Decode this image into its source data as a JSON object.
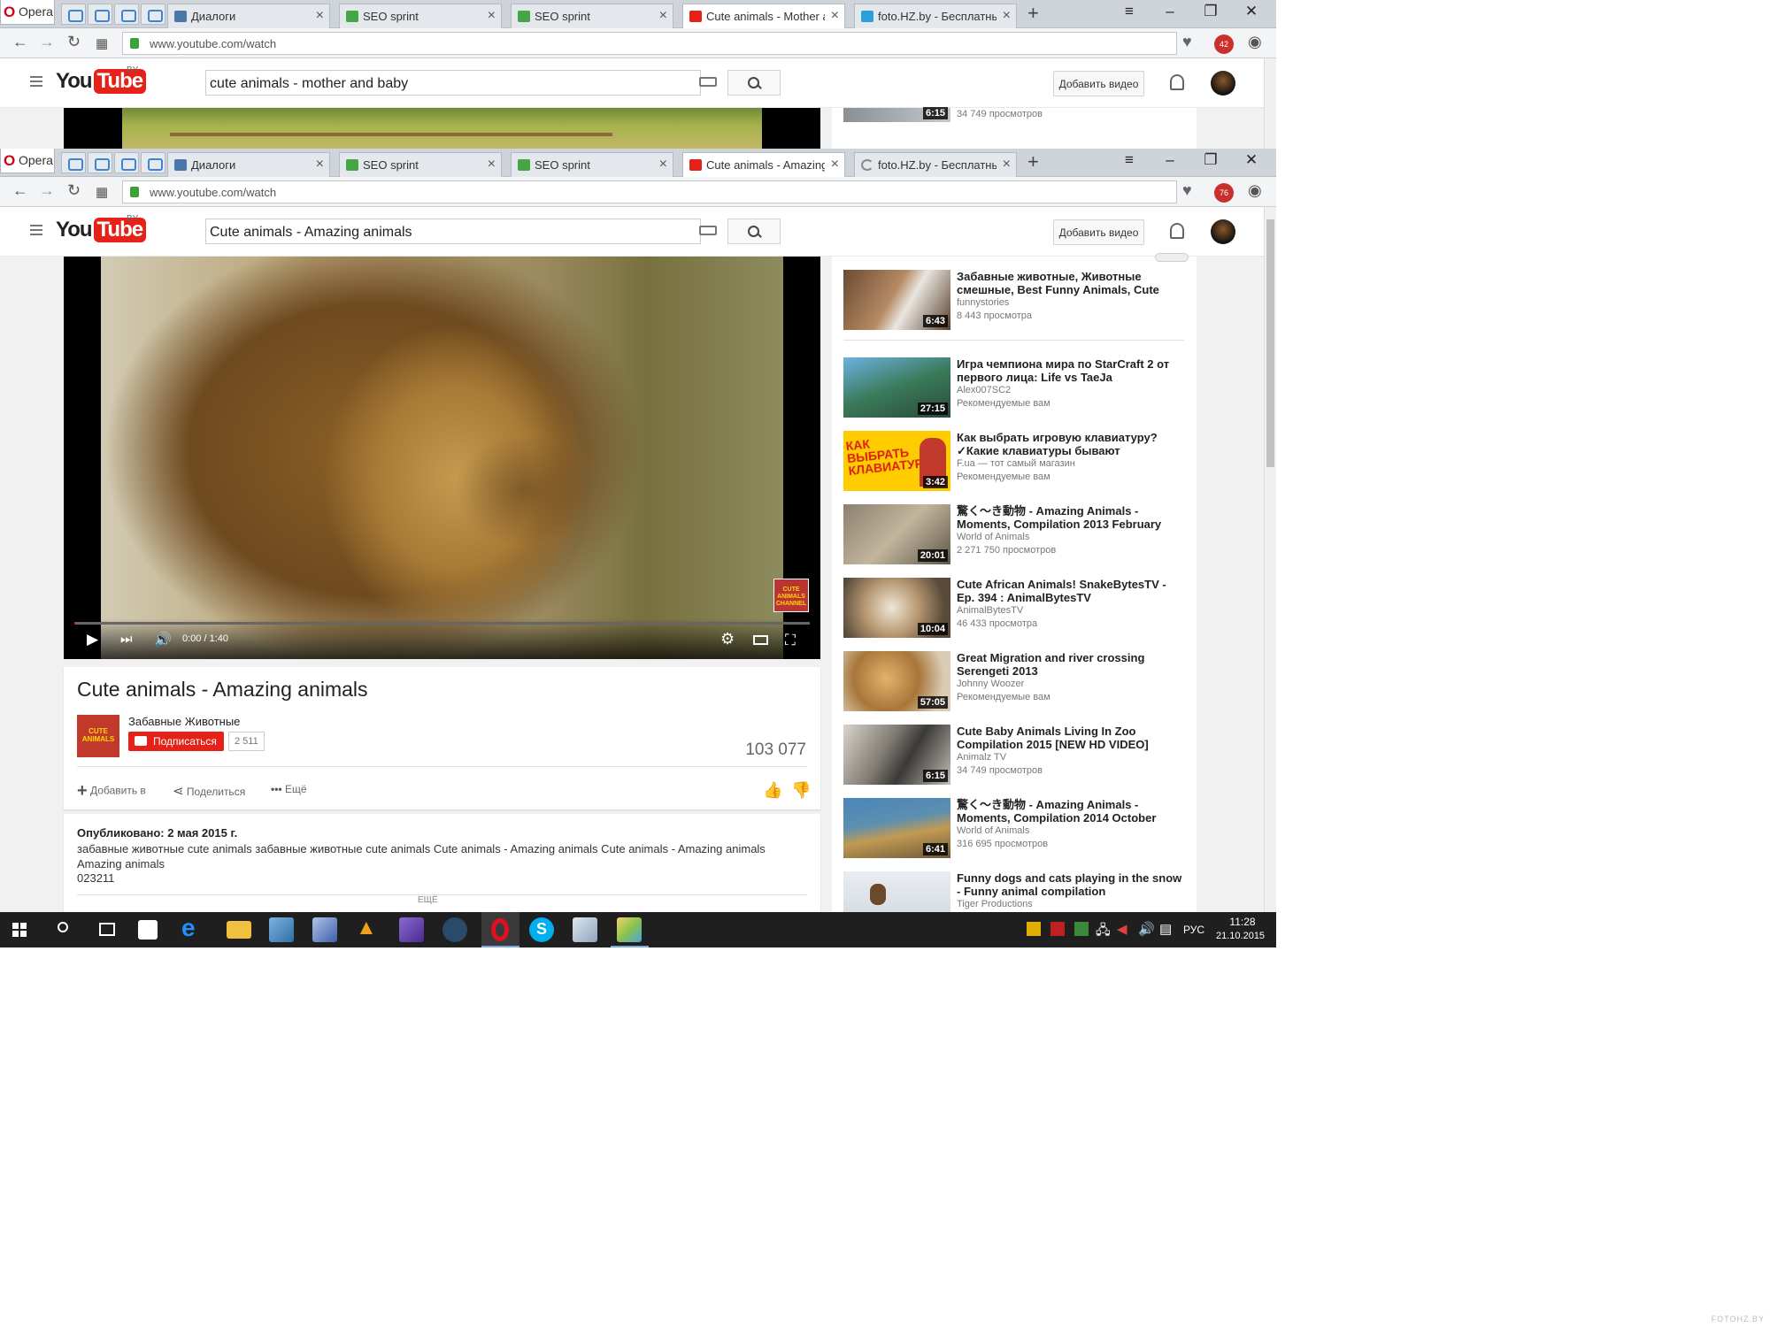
{
  "back_window": {
    "opera_label": "Opera",
    "tabs": [
      "Диалоги",
      "SEO sprint",
      "SEO sprint",
      "Cute animals - Mother and",
      "foto.HZ.by - Бесплатный"
    ],
    "url": "www.youtube.com/watch",
    "search_query": "cute animals - mother and baby",
    "upload_label": "Добавить видео",
    "logo_region": "BY",
    "adblock_count": "42",
    "visible_rec": {
      "duration": "6:15",
      "views": "34 749 просмотров"
    }
  },
  "front_window": {
    "opera_label": "Opera",
    "tabs": [
      "Диалоги",
      "SEO sprint",
      "SEO sprint",
      "Cute animals - Amazing an",
      "foto.HZ.by - Бесплатный"
    ],
    "url": "www.youtube.com/watch",
    "adblock_count": "76",
    "youtube": {
      "logo_you": "You",
      "logo_tube": "Tube",
      "logo_region": "BY",
      "search_query": "Cute animals - Amazing animals",
      "upload_label": "Добавить видео"
    },
    "player": {
      "time": "0:00 / 1:40",
      "progress_fraction": 0.0,
      "watermark": "CUTE ANIMALS CHANNEL"
    },
    "video": {
      "title": "Cute animals - Amazing animals",
      "channel": "Забавные Животные",
      "subscribe_label": "Подписаться",
      "subscriber_count": "2 511",
      "view_count": "103 077",
      "add_to_label": "Добавить в",
      "share_label": "Поделиться",
      "more_label": "Ещё",
      "published": "Опубликовано: 2 мая 2015 г.",
      "description": "забавные животные cute animals забавные животные cute animals Cute animals - Amazing animals Cute animals - Amazing animals Amazing animals",
      "description_code": "023211",
      "show_more": "ЕЩЁ"
    },
    "recommendations": [
      {
        "title": "Забавные животные, Животные смешные, Best Funny Animals, Cute",
        "channel": "funnystories",
        "meta": "8 443 просмотра",
        "duration": "6:43"
      },
      {
        "title": "Игра чемпиона мира по StarCraft 2 от первого лица: Life vs TaeJa",
        "channel": "Alex007SC2",
        "meta": "Рекомендуемые вам",
        "duration": "27:15"
      },
      {
        "title": "Как выбрать игровую клавиатуру? ✓Какие клавиатуры бывают",
        "channel": "F.ua — тот самый магазин",
        "meta": "Рекомендуемые вам",
        "duration": "3:42",
        "thumb_text": "КАК ВЫБРАТЬ КЛАВИАТУРУ"
      },
      {
        "title": "驚く〜き動物 - Amazing Animals - Moments, Compilation 2013 February",
        "channel": "World of Animals",
        "meta": "2 271 750 просмотров",
        "duration": "20:01"
      },
      {
        "title": "Cute African Animals! SnakeBytesTV - Ep. 394 : AnimalBytesTV",
        "channel": "AnimalBytesTV",
        "meta": "46 433 просмотра",
        "duration": "10:04"
      },
      {
        "title": "Great Migration and river crossing Serengeti 2013",
        "channel": "Johnny Woozer",
        "meta": "Рекомендуемые вам",
        "duration": "57:05"
      },
      {
        "title": "Cute Baby Animals Living In Zoo Compilation 2015 [NEW HD VIDEO]",
        "channel": "Animalz TV",
        "meta": "34 749 просмотров",
        "duration": "6:15"
      },
      {
        "title": "驚く〜き動物 - Amazing Animals - Moments, Compilation 2014 October",
        "channel": "World of Animals",
        "meta": "316 695 просмотров",
        "duration": "6:41"
      },
      {
        "title": "Funny dogs and cats playing in the snow - Funny animal compilation",
        "channel": "Tiger Productions",
        "meta": "",
        "duration": ""
      }
    ]
  },
  "taskbar": {
    "language": "РУС",
    "time": "11:28",
    "date": "21.10.2015"
  },
  "watermark": "FOTOHZ.BY",
  "colors": {
    "youtube_red": "#e62117",
    "taskbar": "#1f1f1f",
    "tab_bar": "#cfd4da"
  }
}
